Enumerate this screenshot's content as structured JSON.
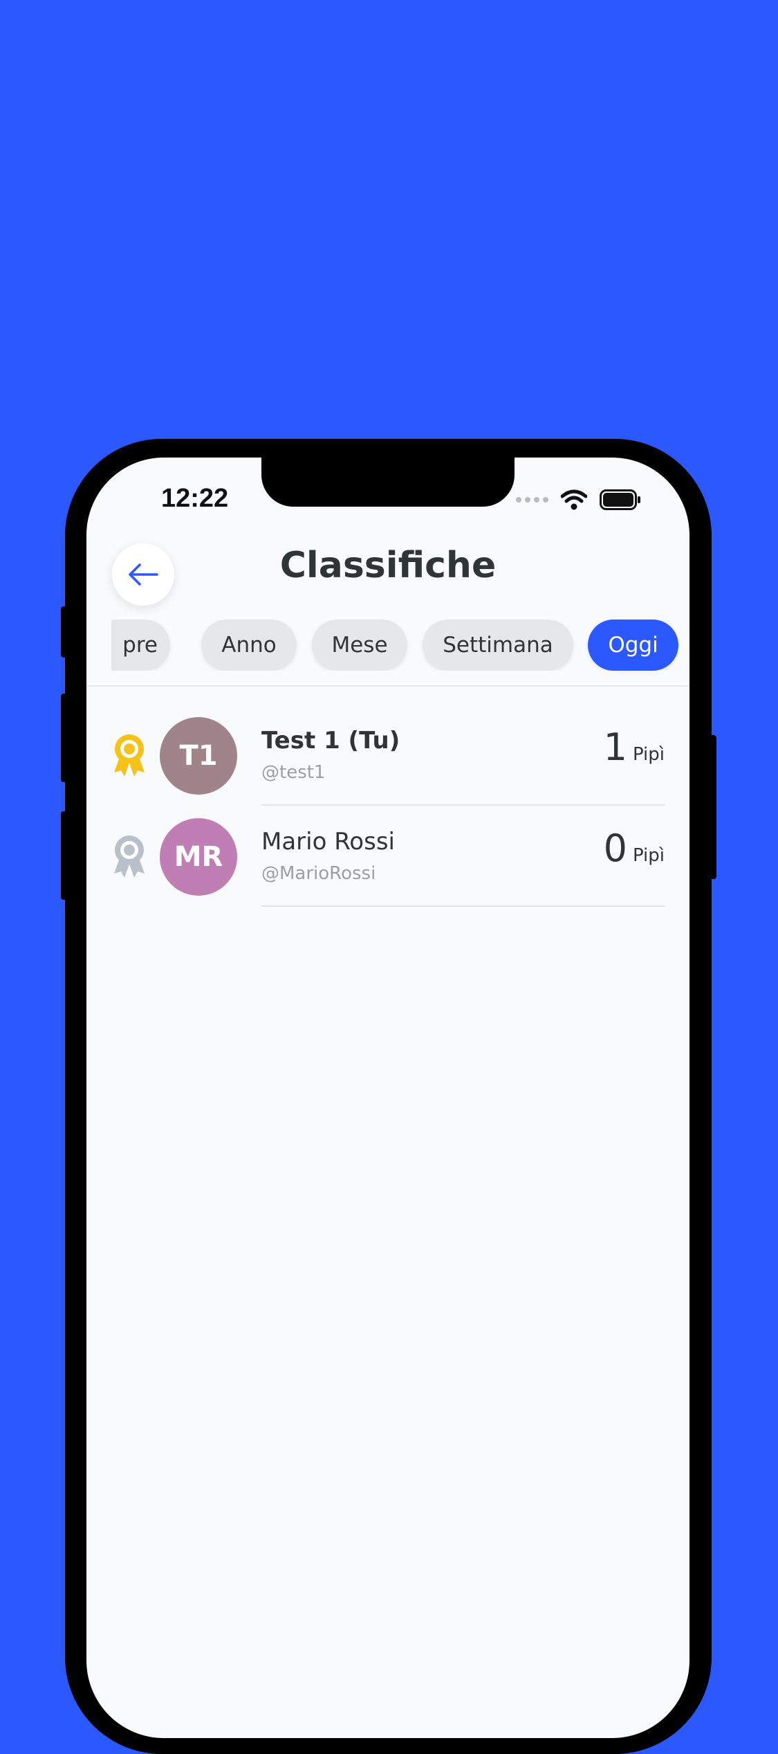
{
  "status": {
    "time": "12:22"
  },
  "header": {
    "title": "Classifiche"
  },
  "colors": {
    "accent": "#2b58ff",
    "gold": "#f5c21a",
    "silver": "#b8c1c9"
  },
  "filters": [
    {
      "label": "Sempre",
      "visible_label": "pre",
      "active": false
    },
    {
      "label": "Anno",
      "active": false
    },
    {
      "label": "Mese",
      "active": false
    },
    {
      "label": "Settimana",
      "active": false
    },
    {
      "label": "Oggi",
      "active": true
    }
  ],
  "leaderboard": [
    {
      "initials": "T1",
      "name": "Test 1 (Tu)",
      "handle": "@test1",
      "score": "1",
      "unit": "Pipì",
      "medal": "gold-medal-icon",
      "avatar_color": "#a0848a"
    },
    {
      "initials": "MR",
      "name": "Mario Rossi",
      "handle": "@MarioRossi",
      "score": "0",
      "unit": "Pipì",
      "medal": "silver-medal-icon",
      "avatar_color": "#c07fb4"
    }
  ]
}
